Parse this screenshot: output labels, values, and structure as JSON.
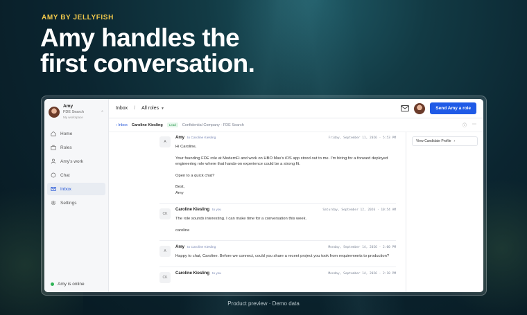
{
  "brand": "AMY BY JELLYFISH",
  "headline": [
    "Amy handles the",
    "first conversation."
  ],
  "caption": "Product preview · Demo data",
  "sidebar": {
    "workspace": {
      "name": "Amy",
      "role": "FDE Search",
      "sub": "My workspace"
    },
    "items": [
      {
        "label": "Home",
        "icon": "home-icon"
      },
      {
        "label": "Roles",
        "icon": "briefcase-icon"
      },
      {
        "label": "Amy's work",
        "icon": "person-icon"
      },
      {
        "label": "Chat",
        "icon": "chat-icon"
      },
      {
        "label": "Inbox",
        "icon": "mail-icon",
        "active": true
      },
      {
        "label": "Settings",
        "icon": "gear-icon"
      }
    ],
    "status": "Amy is online"
  },
  "topbar": {
    "inbox": "Inbox",
    "sep": "/",
    "filter": "All roles",
    "cta": "Send Amy a role"
  },
  "subbar": {
    "back": "Inbox",
    "name": "Caroline Kiesling",
    "badge": "Lead",
    "context": "Confidential Company · FDE Search"
  },
  "rightpanel": {
    "button": "View Candidate Profile"
  },
  "messages": [
    {
      "avatar": "A",
      "from": "Amy",
      "to": "to Caroline Kiesling",
      "time": "Friday, September 11, 2026 · 5:53 PM",
      "paragraphs": [
        "Hi Caroline,",
        "Your founding FDE role at ModernFi and work on HBO Max's iOS app stood out to me. I'm hiring for a forward deployed engineering role where that hands-on experience could be a strong fit.",
        "Open to a quick chat?",
        "Best,\nAmy"
      ]
    },
    {
      "avatar": "CK",
      "from": "Caroline Kiesling",
      "to": "to you",
      "time": "Saturday, September 12, 2026 · 10:54 AM",
      "paragraphs": [
        "The role sounds interesting. I can make time for a conversation this week.",
        "caroline"
      ]
    },
    {
      "avatar": "A",
      "from": "Amy",
      "to": "to Caroline Kiesling",
      "time": "Monday, September 14, 2026 · 2:00 PM",
      "paragraphs": [
        "Happy to chat, Caroline. Before we connect, could you share a recent project you took from requirements to production?"
      ]
    },
    {
      "avatar": "CK",
      "from": "Caroline Kiesling",
      "to": "to you",
      "time": "Monday, September 14, 2026 · 2:18 PM",
      "paragraphs": []
    }
  ],
  "colors": {
    "accent": "#1f5ae6",
    "brand": "#f2c94c",
    "online": "#2fb457"
  }
}
